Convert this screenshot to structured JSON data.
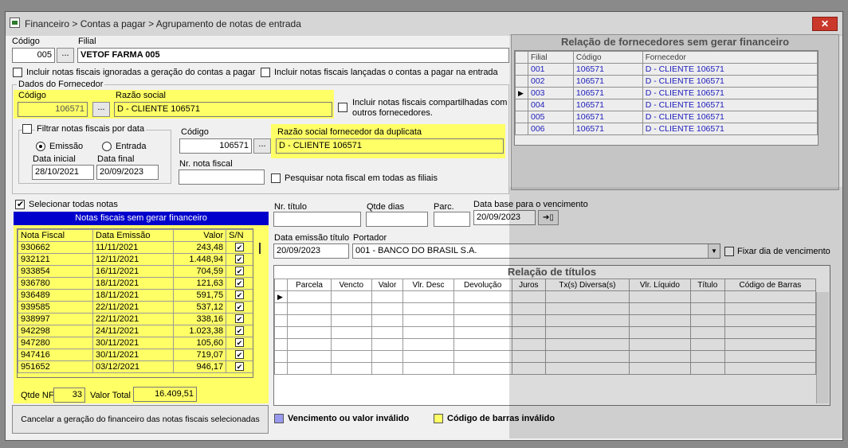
{
  "window": {
    "title": "Financeiro > Contas a pagar > Agrupamento de notas de entrada"
  },
  "header": {
    "codigo_label": "Código",
    "codigo_value": "005",
    "filial_label": "Filial",
    "filial_value": "VETOF FARMA 005",
    "lookup_label": "..."
  },
  "options": {
    "incluir_ignoradas": "Incluir notas fiscais ignoradas a geração do contas a pagar",
    "incluir_lancadas": "Incluir notas fiscais lançadas o contas a pagar na entrada"
  },
  "fornecedor": {
    "group_label": "Dados do Fornecedor",
    "codigo_label": "Código",
    "codigo_value": "106571",
    "razao_label": "Razão social",
    "razao_value": "D - CLIENTE 106571",
    "compartilhadas": "Incluir notas fiscais compartilhadas com outros fornecedores."
  },
  "filtro": {
    "label": "Filtrar notas fiscais por data",
    "emissao": "Emissão",
    "entrada": "Entrada",
    "data_inicial_label": "Data inicial",
    "data_inicial": "28/10/2021",
    "data_final_label": "Data final",
    "data_final": "20/09/2023"
  },
  "duplicata": {
    "codigo_label": "Código",
    "codigo_value": "106571",
    "razao_label": "Razão social fornecedor da duplicata",
    "razao_value": "D - CLIENTE 106571",
    "nr_nota_label": "Nr. nota fiscal",
    "nr_nota_value": "",
    "pesquisar": "Pesquisar nota fiscal em todas as filiais"
  },
  "notas": {
    "select_all": "Selecionar todas notas",
    "title": "Notas fiscais sem gerar financeiro",
    "columns": [
      "Nota Fiscal",
      "Data Emissão",
      "Valor",
      "S/N"
    ],
    "rows": [
      [
        "930662",
        "11/11/2021",
        "243,48"
      ],
      [
        "932121",
        "12/11/2021",
        "1.448,94"
      ],
      [
        "933854",
        "16/11/2021",
        "704,59"
      ],
      [
        "936780",
        "18/11/2021",
        "121,63"
      ],
      [
        "936489",
        "18/11/2021",
        "591,75"
      ],
      [
        "939585",
        "22/11/2021",
        "537,12"
      ],
      [
        "938997",
        "22/11/2021",
        "338,16"
      ],
      [
        "942298",
        "24/11/2021",
        "1.023,38"
      ],
      [
        "947280",
        "30/11/2021",
        "105,60"
      ],
      [
        "947416",
        "30/11/2021",
        "719,07"
      ],
      [
        "951652",
        "03/12/2021",
        "946,17"
      ]
    ],
    "qtde_label": "Qtde NF",
    "qtde_value": "33",
    "valor_total_label": "Valor Total",
    "valor_total": "16.409,51"
  },
  "titulo": {
    "nr_label": "Nr. título",
    "nr_value": "",
    "qtde_dias_label": "Qtde dias",
    "qtde_dias_value": "",
    "parc_label": "Parc.",
    "parc_value": "",
    "data_base_label": "Data base para o vencimento",
    "data_base_value": "20/09/2023",
    "data_emissao_label": "Data emissão título",
    "data_emissao_value": "20/09/2023",
    "portador_label": "Portador",
    "portador_value": "001 - BANCO DO BRASIL S.A.",
    "fixar_label": "Fixar dia de vencimento"
  },
  "relacao_titulos": {
    "title": "Relação de títulos",
    "columns": [
      "Parcela",
      "Vencto",
      "Valor",
      "Vlr. Desc",
      "Devolução",
      "Juros",
      "Tx(s) Diversa(s)",
      "Vlr. Líquido",
      "Título",
      "Código de Barras"
    ]
  },
  "fornecedores_sem_financeiro": {
    "title": "Relação de fornecedores sem gerar financeiro",
    "columns": [
      "Filial",
      "Código",
      "Fornecedor"
    ],
    "rows": [
      [
        "001",
        "106571",
        "D - CLIENTE 106571"
      ],
      [
        "002",
        "106571",
        "D - CLIENTE 106571"
      ],
      [
        "003",
        "106571",
        "D - CLIENTE 106571"
      ],
      [
        "004",
        "106571",
        "D - CLIENTE 106571"
      ],
      [
        "005",
        "106571",
        "D - CLIENTE 106571"
      ],
      [
        "006",
        "106571",
        "D - CLIENTE 106571"
      ]
    ]
  },
  "footer": {
    "cancel_button": "Cancelar a geração do financeiro das notas fiscais selecionadas",
    "legend_vencimento": "Vencimento ou valor inválido",
    "legend_codigo": "Código de barras inválido"
  },
  "colors": {
    "highlight": "#ffff66",
    "header_blue": "#0000cc",
    "legend_purple": "#9999ee"
  }
}
